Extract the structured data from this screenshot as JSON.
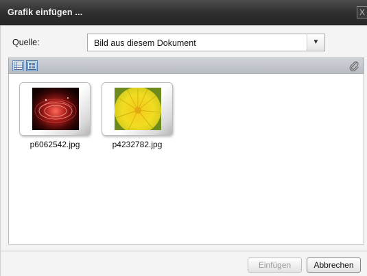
{
  "dialog": {
    "title": "Grafik einfügen ...",
    "close_glyph": "X"
  },
  "source": {
    "label": "Quelle:",
    "selected": "Bild aus diesem Dokument"
  },
  "toolbar": {
    "icons": [
      "list-view-icon",
      "thumbnail-view-icon",
      "paperclip-icon"
    ]
  },
  "files": [
    {
      "name": "p6062542.jpg",
      "thumb": "red-swirl-photo"
    },
    {
      "name": "p4232782.jpg",
      "thumb": "yellow-flower-photo"
    }
  ],
  "buttons": {
    "insert": "Einfügen",
    "cancel": "Abbrechen"
  }
}
